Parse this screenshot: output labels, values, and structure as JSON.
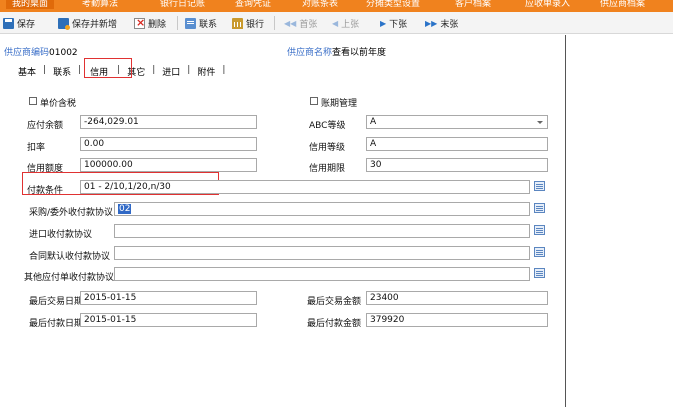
{
  "top_tabs": [
    "我的桌面",
    "考勤算法",
    "银行日记账",
    "查询凭证",
    "对账条表",
    "分摊类型设置",
    "客户档案",
    "应收单录入",
    "供应商档案"
  ],
  "toolbar": {
    "save": "保存",
    "save_new": "保存并新增",
    "delete": "删除",
    "contact": "联系",
    "bank": "银行",
    "first": "首张",
    "prev": "上张",
    "next": "下张",
    "last": "末张"
  },
  "header": {
    "code_label": "供应商编码",
    "code_value": "01002",
    "name_label": "供应商名称",
    "name_value": "查看以前年度"
  },
  "tabs": [
    "基本",
    "联系",
    "信用",
    "其它",
    "进口",
    "附件"
  ],
  "active_tab": "信用",
  "form": {
    "tax_included_label": "单价含税",
    "aging_label": "账期管理",
    "payable_balance_label": "应付余额",
    "payable_balance_value": "-264,029.01",
    "abc_grade_label": "ABC等级",
    "abc_grade_value": "A",
    "discount_label": "扣率",
    "discount_value": "0.00",
    "credit_grade_label": "信用等级",
    "credit_grade_value": "A",
    "credit_limit_label": "信用额度",
    "credit_limit_value": "100000.00",
    "credit_period_label": "信用期限",
    "credit_period_value": "30",
    "payment_terms_label": "付款条件",
    "payment_terms_value": "01 - 2/10,1/20,n/30",
    "purchase_agreement_label": "采购/委外收付款协议",
    "purchase_agreement_value": "02",
    "import_agreement_label": "进口收付款协议",
    "contract_agreement_label": "合同默认收付款协议",
    "other_agreement_label": "其他应付单收付款协议",
    "last_trade_date_label": "最后交易日期",
    "last_trade_date_value": "2015-01-15",
    "last_trade_amount_label": "最后交易金额",
    "last_trade_amount_value": "23400",
    "last_pay_date_label": "最后付款日期",
    "last_pay_date_value": "2015-01-15",
    "last_pay_amount_label": "最后付款金额",
    "last_pay_amount_value": "379920"
  },
  "colors": {
    "accent": "#f0821e",
    "link": "#3b6fc8",
    "highlight": "#e03232"
  }
}
